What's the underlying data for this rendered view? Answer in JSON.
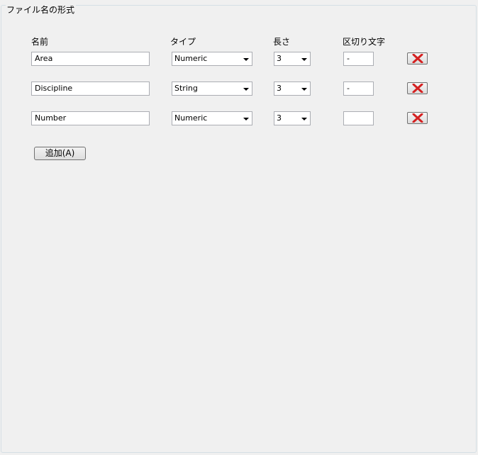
{
  "group": {
    "title": "ファイル名の形式"
  },
  "headers": {
    "name": "名前",
    "type": "タイプ",
    "length": "長さ",
    "separator": "区切り文字"
  },
  "rows": [
    {
      "name": "Area",
      "type": "Numeric",
      "length": "3",
      "separator": "-"
    },
    {
      "name": "Discipline",
      "type": "String",
      "length": "3",
      "separator": "-"
    },
    {
      "name": "Number",
      "type": "Numeric",
      "length": "3",
      "separator": ""
    }
  ],
  "add_button": {
    "label": "追加(A)"
  },
  "colors": {
    "delete_x": "#d42020"
  }
}
